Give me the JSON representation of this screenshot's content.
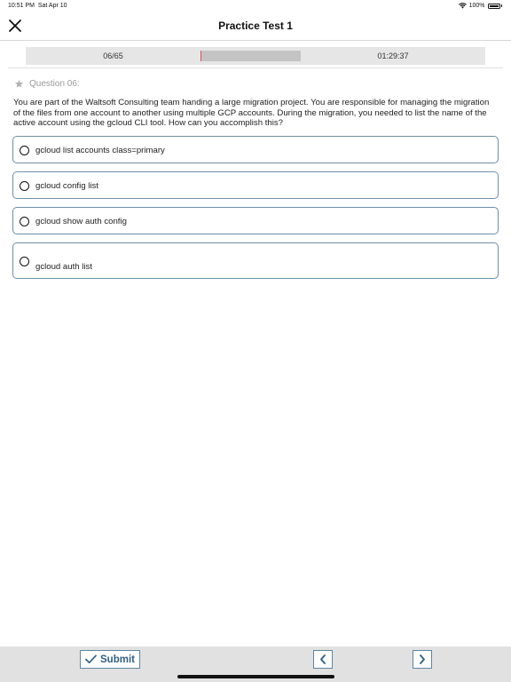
{
  "status_bar": {
    "time": "10:51 PM",
    "date": "Sat Apr 10",
    "battery": "100%",
    "wifi_icon": "wifi-icon",
    "battery_icon": "battery-icon"
  },
  "nav": {
    "title": "Practice Test 1",
    "close_icon": "close-icon"
  },
  "progress": {
    "count": "06/65",
    "fraction": 0.012,
    "timer": "01:29:37",
    "fill_color": "#d9534f"
  },
  "question": {
    "label": "Question 06:",
    "star_icon": "star-icon",
    "text": "You are part of the Waltsoft Consulting team handing a large migration project. You are responsible for managing the migration of the files from one account to another using multiple GCP accounts. During the migration, you needed to list the name of the active account using the gcloud CLI tool. How can you accomplish this?"
  },
  "options": [
    {
      "label": "gcloud list accounts class=primary"
    },
    {
      "label": "gcloud config list"
    },
    {
      "label": "gcloud show auth config"
    },
    {
      "label": "gcloud auth list"
    }
  ],
  "footer": {
    "submit_label": "Submit",
    "check_icon": "check-icon",
    "prev_icon": "chevron-left-icon",
    "next_icon": "chevron-right-icon"
  },
  "colors": {
    "accent": "#2f5f86",
    "option_border": "#6c8fa8"
  }
}
